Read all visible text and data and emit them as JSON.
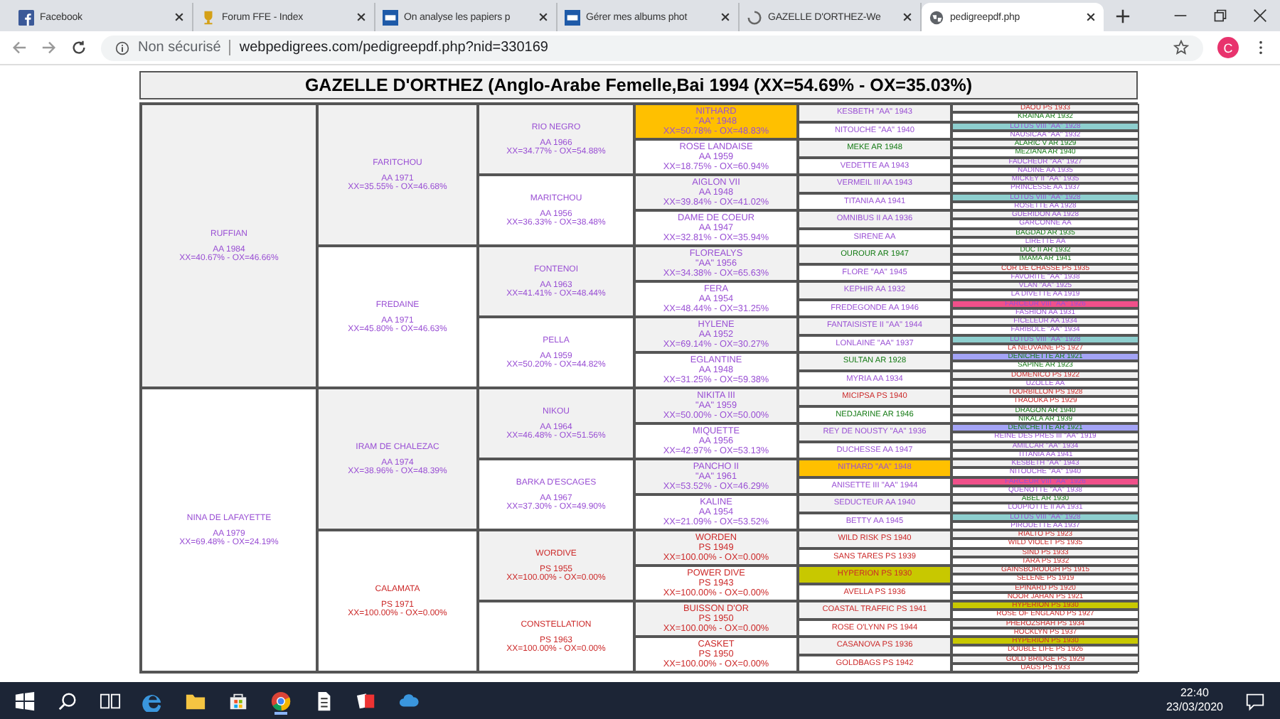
{
  "browser": {
    "tabs": [
      {
        "title": "Facebook",
        "selected": false
      },
      {
        "title": "Forum FFE - Index",
        "selected": false
      },
      {
        "title": "On analyse les papiers p",
        "selected": false
      },
      {
        "title": "Gérer mes albums phot",
        "selected": false
      },
      {
        "title": "GAZELLE D'ORTHEZ-We",
        "selected": false
      },
      {
        "title": "pedigreepdf.php",
        "selected": true
      }
    ],
    "security_label": "Non sécurisé",
    "url": "webpedigrees.com/pedigreepdf.php?nid=330169",
    "profile_initial": "C"
  },
  "pedigree": {
    "title": "GAZELLE D'ORTHEZ (Anglo-Arabe Femelle,Bai 1994 (XX=54.69% - OX=35.03%)",
    "generations": [
      [
        {
          "name": "RUFFIAN",
          "kind": "aa",
          "lines": [
            "AA 1984",
            "XX=40.67% - OX=46.66%"
          ]
        },
        {
          "name": "NINA DE LAFAYETTE",
          "kind": "aa",
          "lines": [
            "AA 1979",
            "XX=69.48% - OX=24.19%"
          ]
        }
      ],
      [
        {
          "name": "FARITCHOU",
          "kind": "aa",
          "lines": [
            "AA 1971",
            "XX=35.55% - OX=46.68%"
          ]
        },
        {
          "name": "FREDAINE",
          "kind": "aa",
          "lines": [
            "AA 1971",
            "XX=45.80% - OX=46.63%"
          ]
        },
        {
          "name": "IRAM DE CHALEZAC",
          "kind": "aa",
          "lines": [
            "AA 1974",
            "XX=38.96% - OX=48.39%"
          ]
        },
        {
          "name": "CALAMATA",
          "kind": "ps",
          "lines": [
            "PS 1971",
            "XX=100.00% - OX=0.00%"
          ]
        }
      ],
      [
        {
          "name": "RIO NEGRO",
          "kind": "aa",
          "lines": [
            "AA 1966",
            "XX=34.77% - OX=54.88%"
          ]
        },
        {
          "name": "MARITCHOU",
          "kind": "aa",
          "lines": [
            "AA 1956",
            "XX=36.33% - OX=38.48%"
          ]
        },
        {
          "name": "FONTENOI",
          "kind": "aa",
          "lines": [
            "AA 1963",
            "XX=41.41% - OX=48.44%"
          ]
        },
        {
          "name": "PELLA",
          "kind": "aa",
          "lines": [
            "AA 1959",
            "XX=50.20% - OX=44.82%"
          ]
        },
        {
          "name": "NIKOU",
          "kind": "aa",
          "lines": [
            "AA 1964",
            "XX=46.48% - OX=51.56%"
          ]
        },
        {
          "name": "BARKA D'ESCAGES",
          "kind": "aa",
          "lines": [
            "AA 1967",
            "XX=37.30% - OX=49.90%"
          ]
        },
        {
          "name": "WORDIVE",
          "kind": "ps",
          "lines": [
            "PS 1955",
            "XX=100.00% - OX=0.00%"
          ]
        },
        {
          "name": "CONSTELLATION",
          "kind": "ps",
          "lines": [
            "PS 1963",
            "XX=100.00% - OX=0.00%"
          ]
        }
      ],
      [
        {
          "name": "NITHARD",
          "kind": "aa",
          "color": "#ffc000",
          "lines": [
            "\"AA\" 1948",
            "XX=50.78% - OX=48.83%"
          ]
        },
        {
          "name": "ROSE LANDAISE",
          "kind": "aa",
          "lines": [
            "AA 1959",
            "XX=18.75% - OX=60.94%"
          ]
        },
        {
          "name": "AIGLON VII",
          "kind": "aa",
          "lines": [
            "AA 1948",
            "XX=39.84% - OX=41.02%"
          ]
        },
        {
          "name": "DAME DE COEUR",
          "kind": "aa",
          "lines": [
            "AA 1947",
            "XX=32.81% - OX=35.94%"
          ]
        },
        {
          "name": "FLOREALYS",
          "kind": "aa",
          "lines": [
            "\"AA\" 1956",
            "XX=34.38% - OX=65.63%"
          ]
        },
        {
          "name": "FERA",
          "kind": "aa",
          "lines": [
            "AA 1954",
            "XX=48.44% - OX=31.25%"
          ]
        },
        {
          "name": "HYLENE",
          "kind": "aa",
          "lines": [
            "AA 1952",
            "XX=69.14% - OX=30.27%"
          ]
        },
        {
          "name": "EGLANTINE",
          "kind": "aa",
          "lines": [
            "AA 1948",
            "XX=31.25% - OX=59.38%"
          ]
        },
        {
          "name": "NIKITA III",
          "kind": "aa",
          "lines": [
            "\"AA\" 1959",
            "XX=50.00% - OX=50.00%"
          ]
        },
        {
          "name": "MIQUETTE",
          "kind": "aa",
          "lines": [
            "AA 1956",
            "XX=42.97% - OX=53.13%"
          ]
        },
        {
          "name": "PANCHO II",
          "kind": "aa",
          "lines": [
            "\"AA\" 1961",
            "XX=53.52% - OX=46.29%"
          ]
        },
        {
          "name": "KALINE",
          "kind": "aa",
          "lines": [
            "AA 1954",
            "XX=21.09% - OX=53.52%"
          ]
        },
        {
          "name": "WORDEN",
          "kind": "ps",
          "lines": [
            "PS 1949",
            "XX=100.00% - OX=0.00%"
          ]
        },
        {
          "name": "POWER DIVE",
          "kind": "ps",
          "lines": [
            "PS 1943",
            "XX=100.00% - OX=0.00%"
          ]
        },
        {
          "name": "BUISSON D'OR",
          "kind": "ps",
          "lines": [
            "PS 1950",
            "XX=100.00% - OX=0.00%"
          ]
        },
        {
          "name": "CASKET",
          "kind": "ps",
          "lines": [
            "PS 1950",
            "XX=100.00% - OX=0.00%"
          ]
        }
      ],
      [
        {
          "name": "KESBETH \"AA\" 1943",
          "kind": "aa"
        },
        {
          "name": "NITOUCHE \"AA\" 1940",
          "kind": "aa"
        },
        {
          "name": "MEKE AR 1948",
          "kind": "ar"
        },
        {
          "name": "VEDETTE AA 1943",
          "kind": "aa"
        },
        {
          "name": "VERMEIL III AA 1943",
          "kind": "aa"
        },
        {
          "name": "TITANIA AA 1941",
          "kind": "aa"
        },
        {
          "name": "OMNIBUS II AA 1936",
          "kind": "aa"
        },
        {
          "name": "SIRENE AA",
          "kind": "aa"
        },
        {
          "name": "OUROUR AR 1947",
          "kind": "ar"
        },
        {
          "name": "FLORE \"AA\" 1945",
          "kind": "aa"
        },
        {
          "name": "KEPHIR AA 1932",
          "kind": "aa"
        },
        {
          "name": "FREDEGONDE AA 1946",
          "kind": "aa"
        },
        {
          "name": "FANTAISISTE II \"AA\" 1944",
          "kind": "aa"
        },
        {
          "name": "LONLAINE \"AA\" 1937",
          "kind": "aa"
        },
        {
          "name": "SULTAN AR 1928",
          "kind": "ar"
        },
        {
          "name": "MYRIA AA 1934",
          "kind": "aa"
        },
        {
          "name": "MICIPSA PS 1940",
          "kind": "ps"
        },
        {
          "name": "NEDJARINE AR 1946",
          "kind": "ar"
        },
        {
          "name": "REY DE NOUSTY \"AA\" 1936",
          "kind": "aa"
        },
        {
          "name": "DUCHESSE AA 1947",
          "kind": "aa"
        },
        {
          "name": "NITHARD \"AA\" 1948",
          "kind": "aa",
          "color": "#ffc000"
        },
        {
          "name": "ANISETTE III \"AA\" 1944",
          "kind": "aa"
        },
        {
          "name": "SEDUCTEUR AA 1940",
          "kind": "aa"
        },
        {
          "name": "BETTY AA 1945",
          "kind": "aa"
        },
        {
          "name": "WILD RISK PS 1940",
          "kind": "ps"
        },
        {
          "name": "SANS TARES PS 1939",
          "kind": "ps"
        },
        {
          "name": "HYPERION PS 1930",
          "kind": "ps",
          "color": "#c8c800"
        },
        {
          "name": "AVELLA PS 1936",
          "kind": "ps"
        },
        {
          "name": "COASTAL TRAFFIC PS 1941",
          "kind": "ps"
        },
        {
          "name": "ROSE O'LYNN PS 1944",
          "kind": "ps"
        },
        {
          "name": "CASANOVA PS 1936",
          "kind": "ps"
        },
        {
          "name": "GOLDBAGS PS 1942",
          "kind": "ps"
        }
      ],
      [
        {
          "name": "DAOU PS 1933",
          "kind": "ps"
        },
        {
          "name": "KRAINA AR 1932",
          "kind": "ar"
        },
        {
          "name": "LOTUS VIII \"AA\" 1928",
          "kind": "aa",
          "color": "#8ecfcf"
        },
        {
          "name": "NAUSICAA \"AA\" 1932",
          "kind": "aa"
        },
        {
          "name": "ALARIC V AR 1929",
          "kind": "ar"
        },
        {
          "name": "MEZIANA AR 1940",
          "kind": "ar"
        },
        {
          "name": "FAUCHEUR \"AA\" 1927",
          "kind": "aa"
        },
        {
          "name": "NADINE AA 1935",
          "kind": "aa"
        },
        {
          "name": "MICKEY II \"AA\" 1935",
          "kind": "aa"
        },
        {
          "name": "PRINCESSE AA 1937",
          "kind": "aa"
        },
        {
          "name": "LOTUS VIII \"AA\" 1928",
          "kind": "aa",
          "color": "#8ecfcf"
        },
        {
          "name": "ROSETTE AA 1928",
          "kind": "aa"
        },
        {
          "name": "GUERIDON AA 1928",
          "kind": "aa"
        },
        {
          "name": "GARCONNE AA",
          "kind": "aa"
        },
        {
          "name": "BAGDAD AR 1935",
          "kind": "ar"
        },
        {
          "name": "LIRETTE AA",
          "kind": "aa"
        },
        {
          "name": "DUC II AR 1932",
          "kind": "ar"
        },
        {
          "name": "IMAMA AR 1941",
          "kind": "ar"
        },
        {
          "name": "COR DE CHASSE PS 1935",
          "kind": "ps"
        },
        {
          "name": "FAVORITE \"AA\" 1938",
          "kind": "aa"
        },
        {
          "name": "VLAN \"AA\" 1925",
          "kind": "aa"
        },
        {
          "name": "LA DIVETTE AA 1919",
          "kind": "aa"
        },
        {
          "name": "FARCEUR VIII \"AA\" 1926",
          "kind": "aa",
          "color": "#f0508a"
        },
        {
          "name": "FASHION AA 1931",
          "kind": "aa"
        },
        {
          "name": "FICELEUR AA 1934",
          "kind": "aa"
        },
        {
          "name": "FARIBOLE \"AA\" 1934",
          "kind": "aa"
        },
        {
          "name": "LOTUS VIII \"AA\" 1928",
          "kind": "aa",
          "color": "#8ecfcf"
        },
        {
          "name": "LA NEUVAINE PS 1927",
          "kind": "ps"
        },
        {
          "name": "DENICHETTE AR 1921",
          "kind": "ar",
          "color": "#a4a4f6"
        },
        {
          "name": "SAPINE AR 1923",
          "kind": "ar"
        },
        {
          "name": "DOMENICO PS 1922",
          "kind": "ps"
        },
        {
          "name": "UZOLLE AA",
          "kind": "aa"
        },
        {
          "name": "TOURBILLON PS 1928",
          "kind": "ps"
        },
        {
          "name": "TRAOUKA PS 1929",
          "kind": "ps"
        },
        {
          "name": "DRAGON AR 1940",
          "kind": "ar"
        },
        {
          "name": "NIKALA AR 1939",
          "kind": "ar"
        },
        {
          "name": "DENICHETTE AR 1921",
          "kind": "ar",
          "color": "#a4a4f6"
        },
        {
          "name": "REINE DES PRES III \"AA\" 1919",
          "kind": "aa"
        },
        {
          "name": "AMILCAR \"AA\" 1934",
          "kind": "aa"
        },
        {
          "name": "TITANIA AA 1941",
          "kind": "aa"
        },
        {
          "name": "KESBETH \"AA\" 1943",
          "kind": "aa"
        },
        {
          "name": "NITOUCHE \"AA\" 1940",
          "kind": "aa"
        },
        {
          "name": "FARCEUR VIII \"AA\" 1926",
          "kind": "aa",
          "color": "#f0508a"
        },
        {
          "name": "QUENOTTE \"AA\" 1938",
          "kind": "aa"
        },
        {
          "name": "ABEL AR 1930",
          "kind": "ar"
        },
        {
          "name": "LOUPIOTTE II AA 1931",
          "kind": "aa"
        },
        {
          "name": "LOTUS VIII \"AA\" 1928",
          "kind": "aa",
          "color": "#8ecfcf"
        },
        {
          "name": "PIROUETTE AA 1937",
          "kind": "aa"
        },
        {
          "name": "RIALTO PS 1923",
          "kind": "ps"
        },
        {
          "name": "WILD VIOLET PS 1935",
          "kind": "ps"
        },
        {
          "name": "SIND PS 1933",
          "kind": "ps"
        },
        {
          "name": "TARA PS 1932",
          "kind": "ps"
        },
        {
          "name": "GAINSBOROUGH PS 1915",
          "kind": "ps"
        },
        {
          "name": "SELENE PS 1919",
          "kind": "ps"
        },
        {
          "name": "EPINARD PS 1920",
          "kind": "ps"
        },
        {
          "name": "NOOR JAHAN PS 1921",
          "kind": "ps"
        },
        {
          "name": "HYPERION PS 1930",
          "kind": "ps",
          "color": "#c8c800"
        },
        {
          "name": "ROSE OF ENGLAND PS 1927",
          "kind": "ps"
        },
        {
          "name": "PHEROZSHAH PS 1934",
          "kind": "ps"
        },
        {
          "name": "ROCKLYN PS 1937",
          "kind": "ps"
        },
        {
          "name": "HYPERION PS 1930",
          "kind": "ps",
          "color": "#c8c800"
        },
        {
          "name": "DOUBLE LIFE PS 1926",
          "kind": "ps"
        },
        {
          "name": "GOLD BRIDGE PS 1929",
          "kind": "ps"
        },
        {
          "name": "UAGS PS 1933",
          "kind": "ps"
        }
      ]
    ]
  },
  "taskbar": {
    "time": "22:40",
    "date": "23/03/2020"
  }
}
